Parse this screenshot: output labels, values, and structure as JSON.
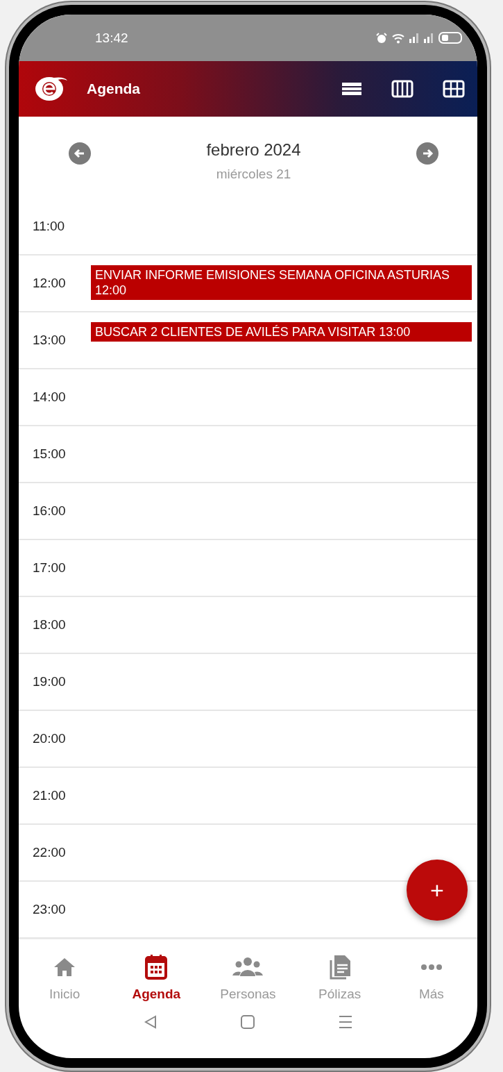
{
  "status_bar": {
    "time": "13:42"
  },
  "header": {
    "title": "Agenda"
  },
  "date_nav": {
    "month": "febrero 2024",
    "day": "miércoles 21"
  },
  "hours": [
    {
      "time": "11:00"
    },
    {
      "time": "12:00",
      "events": [
        "ENVIAR INFORME EMISIONES SEMANA OFICINA ASTURIAS 12:00"
      ]
    },
    {
      "time": "13:00",
      "events": [
        "BUSCAR 2 CLIENTES DE AVILÉS PARA VISITAR 13:00"
      ]
    },
    {
      "time": "14:00"
    },
    {
      "time": "15:00"
    },
    {
      "time": "16:00"
    },
    {
      "time": "17:00"
    },
    {
      "time": "18:00"
    },
    {
      "time": "19:00"
    },
    {
      "time": "20:00"
    },
    {
      "time": "21:00"
    },
    {
      "time": "22:00"
    },
    {
      "time": "23:00"
    }
  ],
  "fab": {
    "label": "+"
  },
  "bottom_nav": [
    {
      "kind": "home",
      "label": "Inicio",
      "selected": false
    },
    {
      "kind": "calendar",
      "label": "Agenda",
      "selected": true
    },
    {
      "kind": "people",
      "label": "Personas",
      "selected": false
    },
    {
      "kind": "documents",
      "label": "Pólizas",
      "selected": false
    },
    {
      "kind": "more",
      "label": "Más",
      "selected": false
    }
  ]
}
